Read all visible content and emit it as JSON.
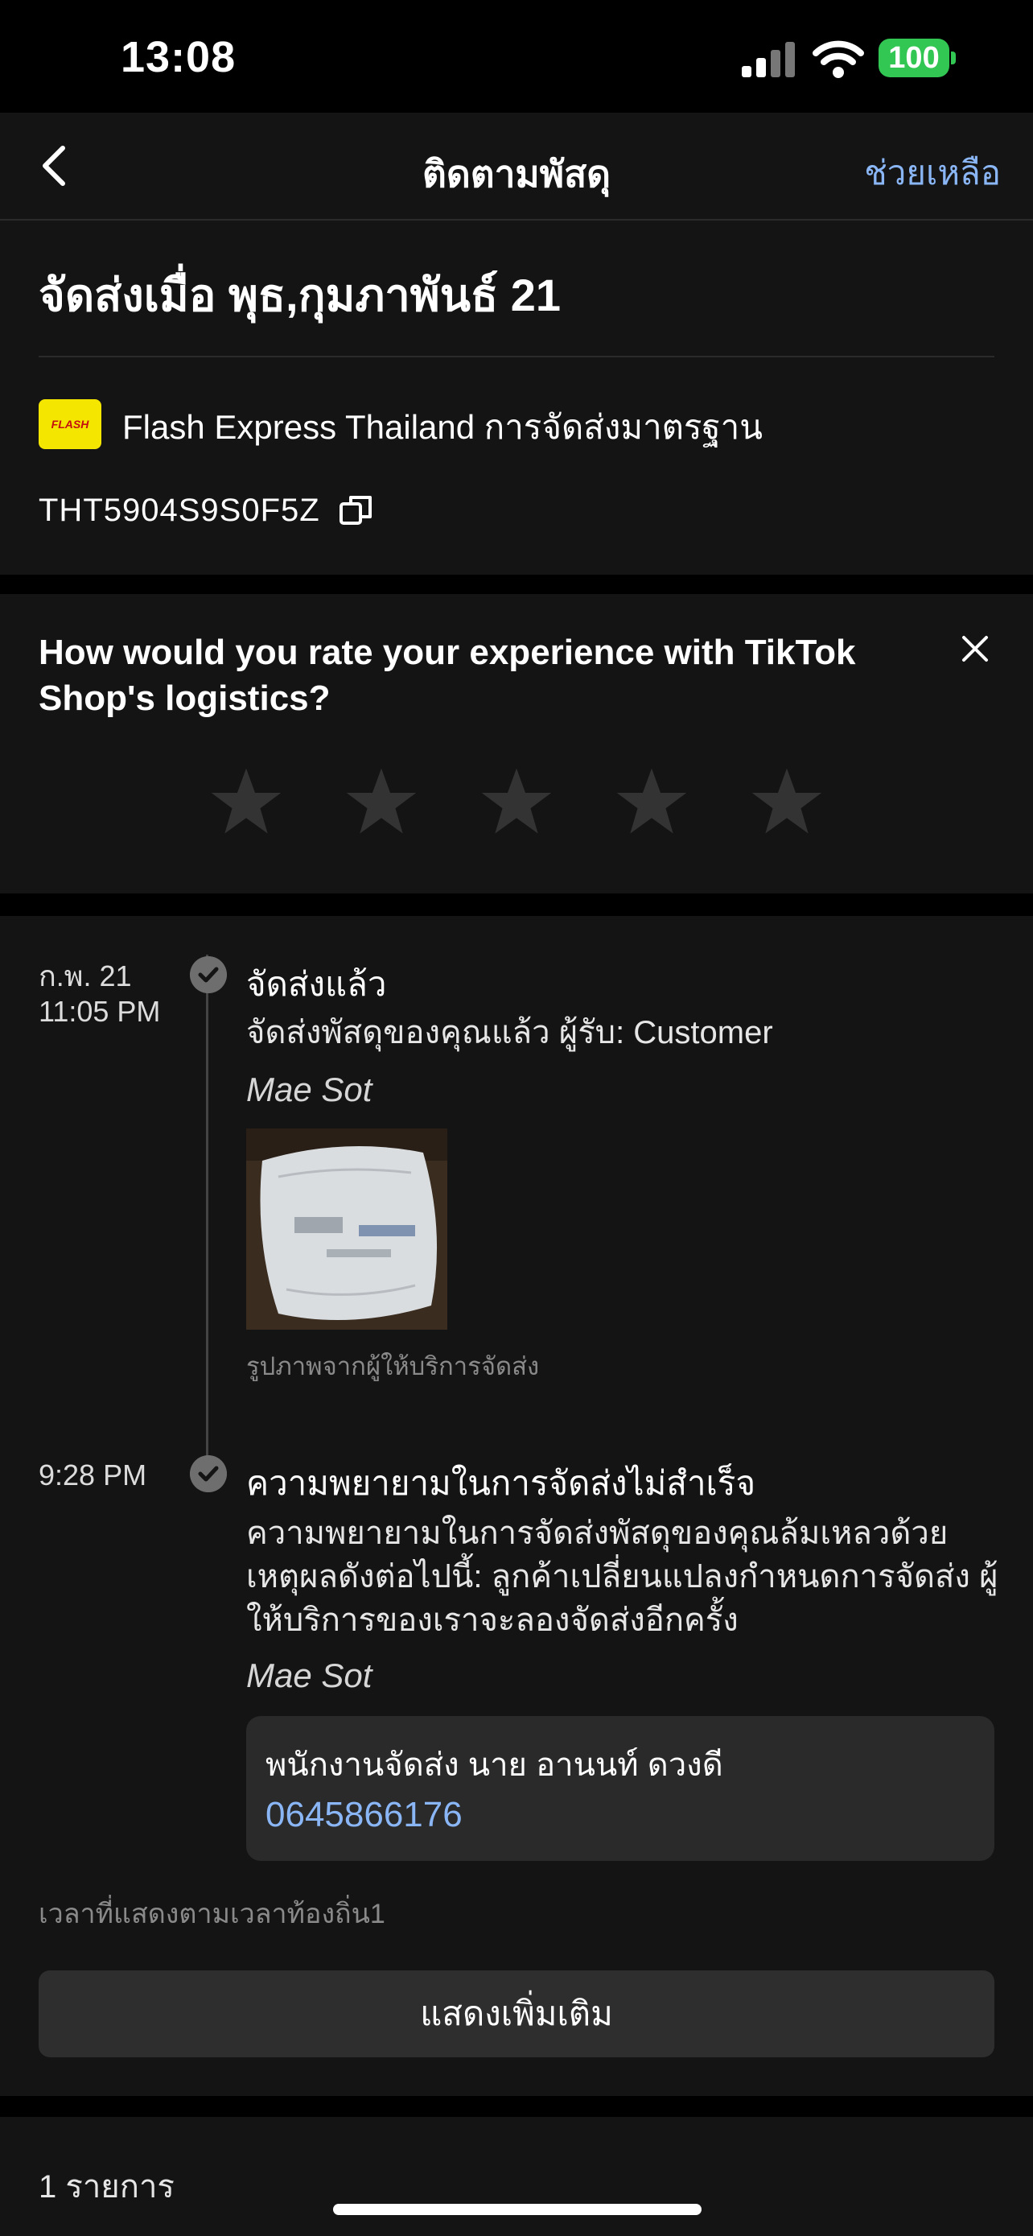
{
  "status_bar": {
    "time": "13:08",
    "battery": "100"
  },
  "header": {
    "title": "ติดตามพัสดุ",
    "help": "ช่วยเหลือ"
  },
  "shipment": {
    "date_label": "จัดส่งเมื่อ พุธ,กุมภาพันธ์ 21",
    "carrier_logo_text": "FLASH",
    "carrier": "Flash Express Thailand การจัดส่งมาตรฐาน",
    "tracking_number": "THT5904S9S0F5Z"
  },
  "rating": {
    "question": "How would you rate your experience with TikTok Shop's logistics?",
    "stars": 5,
    "selected": 0
  },
  "timeline": {
    "events": [
      {
        "date": "ก.พ. 21",
        "time": "11:05 PM",
        "title": "จัดส่งแล้ว",
        "body": "จัดส่งพัสดุของคุณแล้ว ผู้รับ: Customer",
        "location": "Mae Sot",
        "photo_caption": "รูปภาพจากผู้ให้บริการจัดส่ง"
      },
      {
        "time": "9:28 PM",
        "title": "ความพยายามในการจัดส่งไม่สำเร็จ",
        "body": "ความพยายามในการจัดส่งพัสดุของคุณล้มเหลวด้วยเหตุผลดังต่อไปนี้: ลูกค้าเปลี่ยนแปลงกำหนดการจัดส่ง ผู้ให้บริการของเราจะลองจัดส่งอีกครั้ง",
        "location": "Mae Sot",
        "courier_label": "พนักงานจัดส่ง  นาย อานนท์ ดวงดี",
        "courier_phone": "0645866176"
      }
    ],
    "timezone_note": "เวลาที่แสดงตามเวลาท้องถิ่น1",
    "show_more": "แสดงเพิ่มเติม"
  },
  "items": {
    "count_label": "1 รายการ"
  },
  "colors": {
    "accent_link": "#8ab6f5",
    "battery": "#32c653",
    "background": "#141414"
  }
}
